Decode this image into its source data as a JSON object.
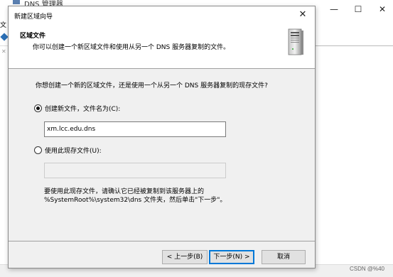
{
  "background_window": {
    "title": "DNS 管理器",
    "menu_first": "文",
    "controls": {
      "minimize": "—",
      "maximize": "☐",
      "close": "✕"
    },
    "watermark": "CSDN @%40"
  },
  "dialog": {
    "title": "新建区域向导",
    "close_glyph": "✕",
    "header": {
      "title": "区域文件",
      "subtitle": "你可以创建一个新区域文件和使用从另一个 DNS 服务器复制的文件。"
    },
    "question": "你想创建一个新的区域文件，还是使用一个从另一个 DNS 服务器复制的现存文件?",
    "options": {
      "create_new": {
        "label": "创建新文件，文件名为(C):",
        "checked": true,
        "value": "xm.lcc.edu.dns"
      },
      "use_existing": {
        "label": "使用此现存文件(U):",
        "checked": false,
        "value": ""
      }
    },
    "note_line1": "要使用此现存文件，请确认它已经被复制到该服务器上的",
    "note_line2": "%SystemRoot%\\system32\\dns 文件夹，然后单击\"下一步\"。",
    "buttons": {
      "back": "< 上一步(B)",
      "next": "下一步(N) >",
      "cancel": "取消"
    }
  }
}
